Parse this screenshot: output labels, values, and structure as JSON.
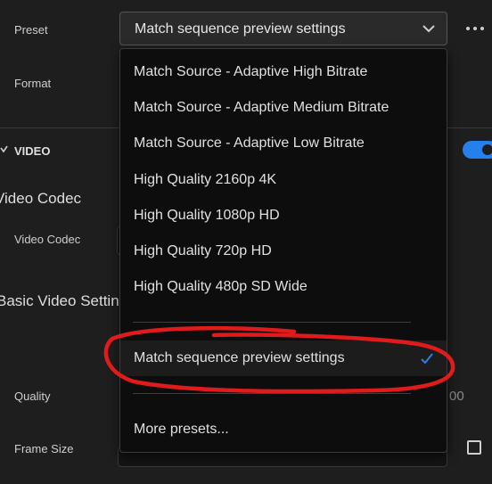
{
  "preset": {
    "label": "Preset",
    "value": "Match sequence preview settings",
    "more_icon": "more-horizontal-icon"
  },
  "format": {
    "label": "Format"
  },
  "video": {
    "section_label": "VIDEO",
    "enabled": true,
    "codec_heading": "Video Codec",
    "codec_label": "Video Codec",
    "basic_settings_heading": "Basic Video Settings",
    "quality_label": "Quality",
    "quality_value_partial": "00",
    "frame_size_label": "Frame Size"
  },
  "menu": {
    "items": [
      "Match Source - Adaptive High Bitrate",
      "Match Source - Adaptive Medium Bitrate",
      "Match Source - Adaptive Low Bitrate",
      "High Quality 2160p 4K",
      "High Quality 1080p HD",
      "High Quality 720p HD",
      "High Quality 480p SD Wide"
    ],
    "selected_item": "Match sequence preview settings",
    "more_item": "More presets..."
  },
  "colors": {
    "accent": "#2680eb",
    "annotation": "#e01b1b",
    "background": "#1e1e1e",
    "menu_background": "#0d0d0d"
  }
}
